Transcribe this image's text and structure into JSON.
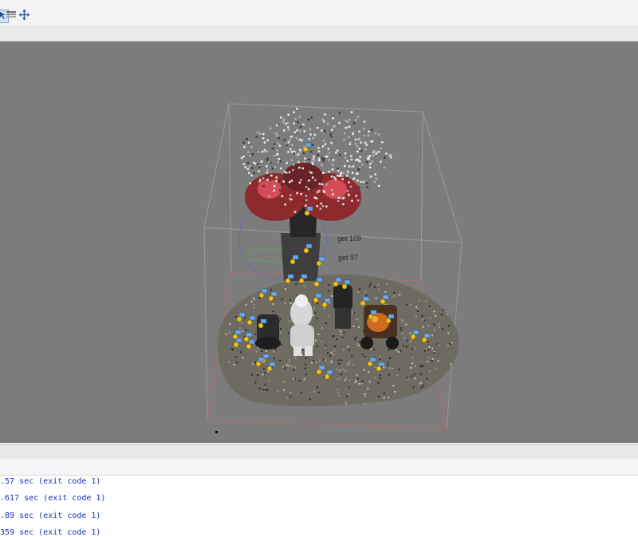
{
  "toolbar": {
    "icons": [
      "select-icon",
      "layers-icon",
      "move-icon"
    ]
  },
  "viewport": {
    "background": "#7c7c7c",
    "marker_labels": [
      "get 109",
      "get 97"
    ]
  },
  "console": {
    "lines": [
      ".57 sec (exit code 1)",
      ".617 sec (exit code 1)",
      ".89 sec (exit code 1)",
      "359 sec (exit code 1)"
    ]
  }
}
